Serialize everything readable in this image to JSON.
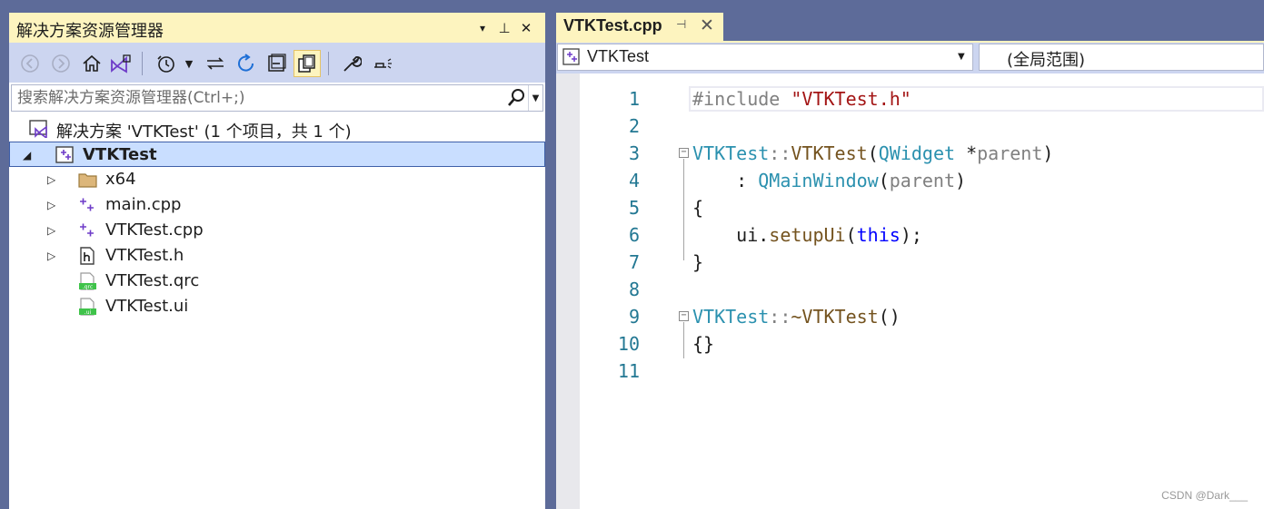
{
  "solution_explorer": {
    "title": "解决方案资源管理器",
    "title_buttons": [
      "▾",
      "⊥",
      "✕"
    ],
    "search_placeholder": "搜索解决方案资源管理器(Ctrl+;)",
    "tree": [
      {
        "label": "解决方案 'VTKTest' (1 个项目，共 1 个)",
        "icon": "solution-icon",
        "expander": ""
      },
      {
        "label": "VTKTest",
        "icon": "cpp-project-icon",
        "expander": "◢",
        "selected": true
      },
      {
        "label": "x64",
        "icon": "folder-icon",
        "expander": "▷"
      },
      {
        "label": "main.cpp",
        "icon": "cpp-file-icon",
        "expander": "▷"
      },
      {
        "label": "VTKTest.cpp",
        "icon": "cpp-file-icon",
        "expander": "▷"
      },
      {
        "label": "VTKTest.h",
        "icon": "header-file-icon",
        "expander": "▷"
      },
      {
        "label": "VTKTest.qrc",
        "icon": "qrc-file-icon",
        "expander": ""
      },
      {
        "label": "VTKTest.ui",
        "icon": "ui-file-icon",
        "expander": ""
      }
    ],
    "qrc_badge": ".qrc",
    "ui_badge": ".ui"
  },
  "editor": {
    "tab_label": "VTKTest.cpp",
    "nav_project": "VTKTest",
    "nav_scope": "(全局范围)",
    "line_numbers": [
      "1",
      "2",
      "3",
      "4",
      "5",
      "6",
      "7",
      "8",
      "9",
      "10",
      "11"
    ],
    "code": {
      "l1_pre": "#include ",
      "l1_str": "\"VTKTest.h\"",
      "l3_cls": "VTKTest",
      "l3_sep": "::",
      "l3_fn": "VTKTest",
      "l3_open": "(",
      "l3_type": "QWidget",
      "l3_ptr": " *",
      "l3_param": "parent",
      "l3_close": ")",
      "l4_colon": "    : ",
      "l4_cls": "QMainWindow",
      "l4_open": "(",
      "l4_param": "parent",
      "l4_close": ")",
      "l5": "{",
      "l6_ident": "    ui",
      "l6_dot": ".",
      "l6_fn": "setupUi",
      "l6_open": "(",
      "l6_kw": "this",
      "l6_close": ");",
      "l7": "}",
      "l9_cls": "VTKTest",
      "l9_sep": "::",
      "l9_fn": "~VTKTest",
      "l9_parens": "()",
      "l10": "{}"
    }
  },
  "watermark": "CSDN @Dark___"
}
